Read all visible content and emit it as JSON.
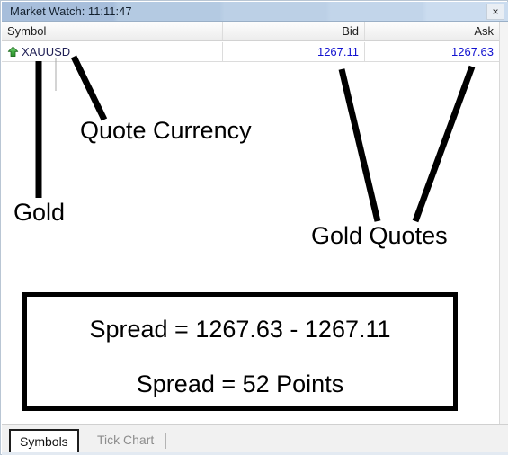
{
  "window": {
    "title": "Market Watch: 11:11:47",
    "close_label": "×",
    "close_icon": "close-icon"
  },
  "table": {
    "columns": [
      {
        "key": "symbol",
        "label": "Symbol"
      },
      {
        "key": "bid",
        "label": "Bid"
      },
      {
        "key": "ask",
        "label": "Ask"
      }
    ],
    "rows": [
      {
        "icon": "green-up-arrow-icon",
        "symbol": "XAUUSD",
        "bid": "1267.11",
        "ask": "1267.63"
      }
    ]
  },
  "annotations": {
    "quote_currency": "Quote Currency",
    "gold": "Gold",
    "gold_quotes": "Gold Quotes"
  },
  "spread_box": {
    "line1": "Spread = 1267.63 - 1267.11",
    "line2": "Spread = 52 Points"
  },
  "tabs": [
    {
      "label": "Symbols",
      "active": true
    },
    {
      "label": "Tick Chart",
      "active": false
    }
  ],
  "colors": {
    "quote_blue": "#1212d0",
    "arrow_green": "#3aa63a",
    "titlebar_blue": "#a7bedb",
    "annotation_black": "#000000"
  }
}
